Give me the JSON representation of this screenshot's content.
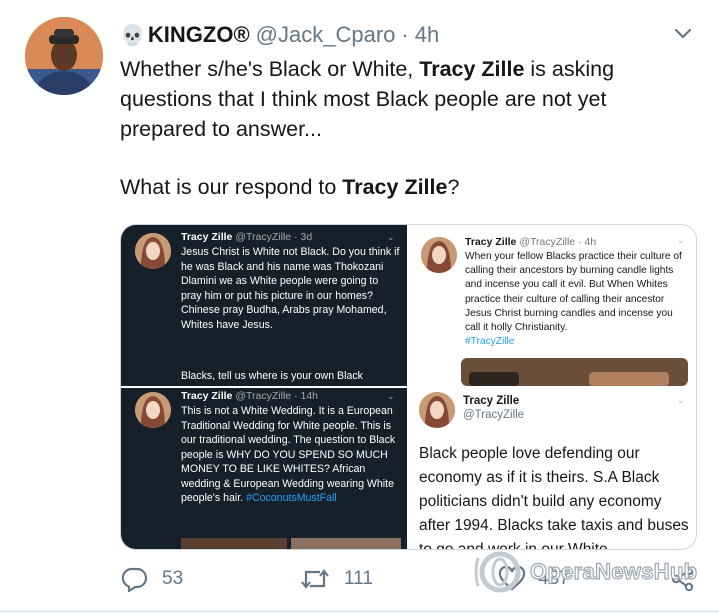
{
  "tweet": {
    "display_name": "KINGZO®",
    "handle": "@Jack_Cparo",
    "separator": "·",
    "time": "4h",
    "text_line1_pre": "Whether s/he's Black or White, ",
    "text_line1_bold": "Tracy Zille",
    "text_line1_post": " is asking questions that I think most Black people are not yet prepared to answer...",
    "text_line2_pre": "What is our respond to ",
    "text_line2_bold": "Tracy Zille",
    "text_line2_post": "?",
    "reply_count": "53",
    "retweet_count": "111",
    "like_count": "487"
  },
  "embedded": {
    "top_left": {
      "name": "Tracy Zille",
      "handle": "@TracyZille · 3d",
      "body": "Jesus Christ is White not Black. Do you think if he was Black and his name was Thokozani Dlamini we as White people were going to pray him or put his picture in our homes? Chinese pray Budha, Arabs pray Mohamed, Whites have Jesus.",
      "body2": "Blacks, tell us where is your own Black"
    },
    "top_right": {
      "name": "Tracy Zille",
      "handle": "@TracyZille · 4h",
      "body": "When your fellow Blacks practice their culture of calling their ancestors by burning candle lights and incense you call it evil. But When Whites practice their culture of calling their ancestor Jesus Christ burning candles and incense you call it holly Christianity.",
      "hashtag": "#TracyZille"
    },
    "bottom_left": {
      "name": "Tracy Zille",
      "handle": "@TracyZille · 14h",
      "body": "This is not a White Wedding. It is a European Traditional Wedding for White people. This is our traditional wedding. The question to Black people is WHY DO YOU SPEND SO MUCH MONEY TO BE LIKE WHITES? African wedding & European Wedding wearing White people's hair.",
      "hashtag": "#CoconutsMustFall"
    },
    "bottom_right": {
      "name": "Tracy Zille",
      "handle": "@TracyZille",
      "body": "Black people love defending our economy as if it is theirs. S.A Black politicians didn't build any economy after 1994. Blacks take taxis and buses to go and work in our White"
    }
  },
  "watermark": {
    "text": "OperaNewsHub"
  },
  "colors": {
    "accent": "#1da1f2",
    "dark_panel": "#15202b",
    "muted": "#657786"
  }
}
